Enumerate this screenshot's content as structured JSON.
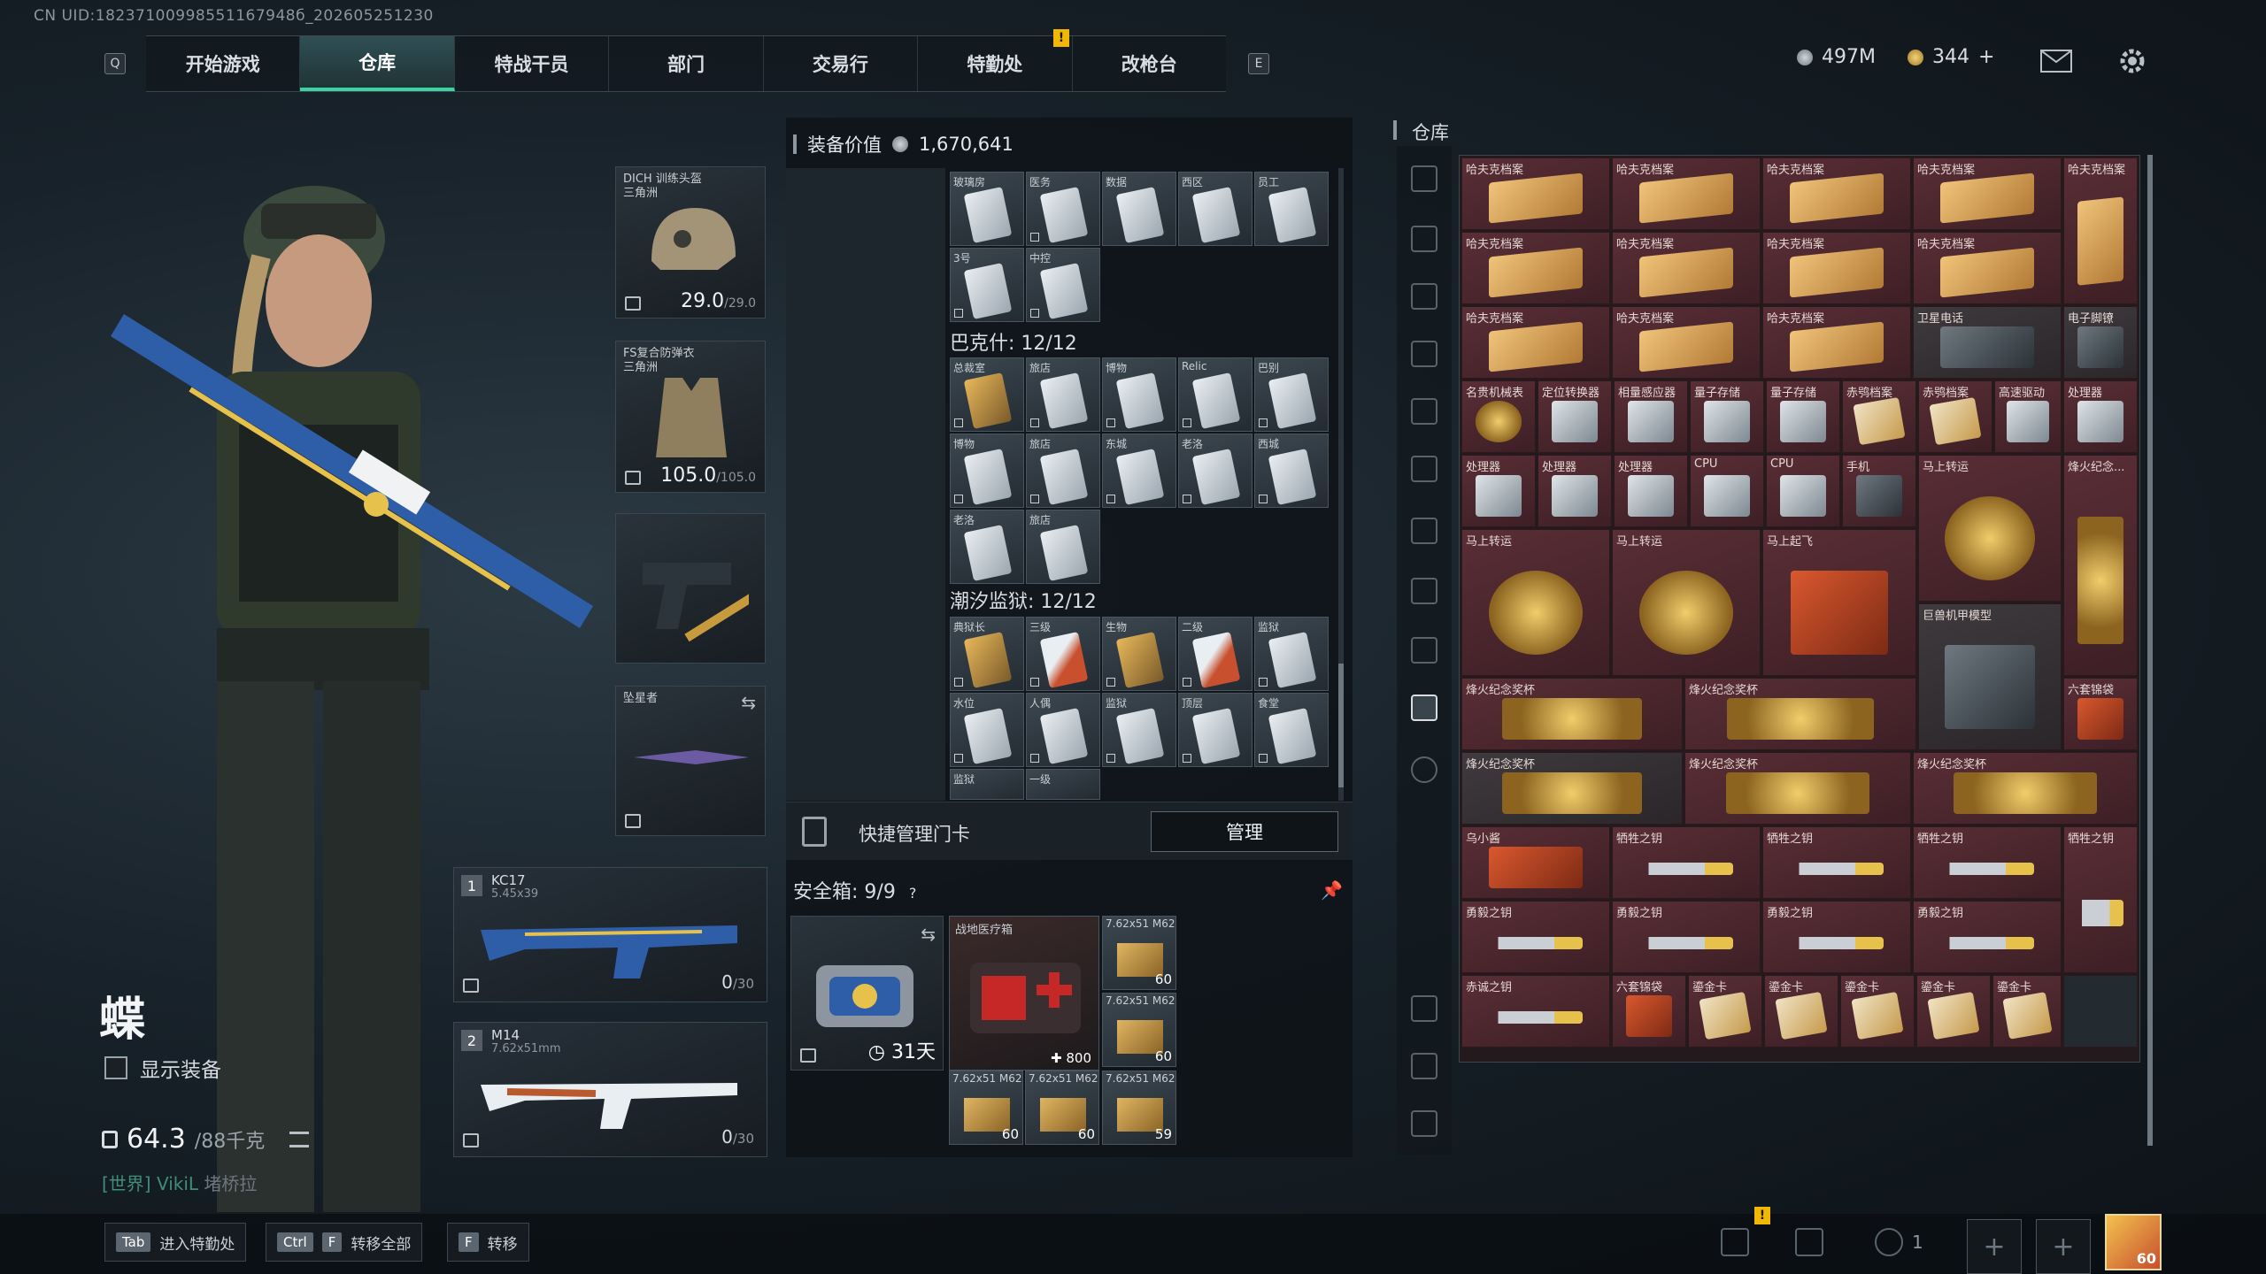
{
  "uid": "CN UID:18237100998551167948б_202605251230",
  "nav": {
    "key_left": "Q",
    "key_right": "E",
    "alert": "!",
    "tabs": [
      "开始游戏",
      "仓库",
      "特战干员",
      "部门",
      "交易行",
      "特勤处",
      "改枪台"
    ],
    "active_tab": "仓库"
  },
  "currency": {
    "coins": "497M",
    "bonds": "344",
    "plus": "+"
  },
  "character": {
    "name": "蝶",
    "show_equipment": "显示装备",
    "weight_value": "64.3",
    "weight_cap": "/88千克",
    "world_channel": "[世界]",
    "world_user": "VikiL",
    "world_msg": "堵桥拉"
  },
  "gear": {
    "helmet_name": "DICH 训练头盔",
    "helmet_sub": "三角洲",
    "helmet_dur": "29.0",
    "helmet_max": "/29.0",
    "armor_name": "FS复合防弹衣",
    "armor_sub": "三角洲",
    "armor_dur": "105.0",
    "armor_max": "/105.0",
    "melee_name": "坠星者"
  },
  "weapons": [
    {
      "num": "1",
      "name": "KC17",
      "cal": "5.45x39",
      "ammo": "0",
      "max": "/30"
    },
    {
      "num": "2",
      "name": "M14",
      "cal": "7.62x51mm",
      "ammo": "0",
      "max": "/30"
    }
  ],
  "equip_value": {
    "label": "装备价值",
    "value": "1,670,641"
  },
  "card_groups": [
    {
      "title": "",
      "cards": [
        "玻璃房",
        "医务",
        "数据",
        "西区",
        "员工",
        "3号",
        "中控"
      ]
    },
    {
      "title": "巴克什: 12/12",
      "cards": [
        "总裁室",
        "旅店",
        "博物",
        "Relic",
        "巴别",
        "博物",
        "旅店",
        "东城",
        "老洛",
        "西城",
        "老洛",
        "旅店"
      ]
    },
    {
      "title": "潮汐监狱: 12/12",
      "cards": [
        "典狱长",
        "三级",
        "生物",
        "二级",
        "监狱",
        "水位",
        "人偶",
        "监狱",
        "顶层",
        "食堂",
        "监狱",
        "一级"
      ]
    }
  ],
  "quick_manage": {
    "label": "快捷管理门卡",
    "button": "管理"
  },
  "safe": {
    "title": "安全箱:",
    "count": "9/9",
    "help": "?",
    "days": "31天",
    "medkit_name": "战地医疗箱",
    "medkit_val": "800",
    "ammo_label": "7.62x51 M62",
    "ammo_counts": [
      "60",
      "60",
      "60",
      "60",
      "60",
      "59"
    ]
  },
  "warehouse": {
    "title": "仓库",
    "labels": {
      "folder": "哈夫克档案",
      "sat": "卫星电话",
      "lock": "电子脚镣",
      "watch": "名贵机械表",
      "locator": "定位转换器",
      "sensor": "相量感应器",
      "quantum": "量子存储",
      "red_file": "赤鸮档案",
      "fast": "高速驱动",
      "cpu_proc": "处理器",
      "cpu": "CPU",
      "phone": "手机",
      "mashang": "马上转运",
      "memorial": "烽火纪念...",
      "maqifei": "马上起飞",
      "mecha": "巨兽机甲模型",
      "cup": "烽火纪念奖杯",
      "bag": "六套锦袋",
      "duck": "乌小酱",
      "sacrifice": "牺牲之钥",
      "brave": "勇毅之钥",
      "loyal": "赤诚之钥",
      "gold_card": "鎏金卡"
    }
  },
  "bottom": {
    "hk1_key": "Tab",
    "hk1": "进入特勤处",
    "hk2_key1": "Ctrl",
    "hk2_key2": "F",
    "hk2": "转移全部",
    "hk3_key": "F",
    "hk3": "转移",
    "friends": "1",
    "level": "60"
  },
  "colors": {
    "accent": "#3bd3a0",
    "warehouse_bg": "#5a2e36",
    "alert": "#f2b705"
  }
}
